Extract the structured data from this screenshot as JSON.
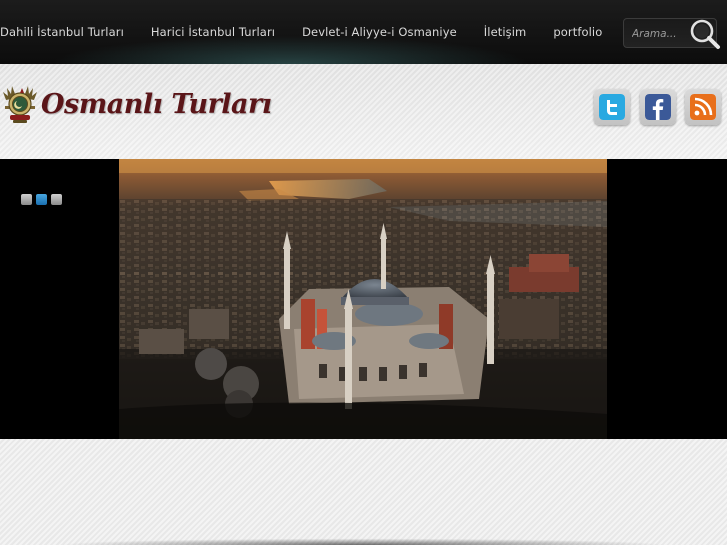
{
  "nav": {
    "items": [
      {
        "label": "Dahili İstanbul Turları"
      },
      {
        "label": "Harici İstanbul Turları"
      },
      {
        "label": "Devlet-i Aliyye-i Osmaniye"
      },
      {
        "label": "İletişim"
      },
      {
        "label": "portfolio"
      }
    ]
  },
  "search": {
    "placeholder": "Arama..."
  },
  "logo": {
    "text": "Osmanlı Turları",
    "icon": "ottoman-coat-of-arms-icon",
    "color": "#5a1518"
  },
  "social": [
    {
      "name": "twitter",
      "icon": "twitter-icon",
      "color": "#29a9e1"
    },
    {
      "name": "facebook",
      "icon": "facebook-icon",
      "color": "#3b5998"
    },
    {
      "name": "rss",
      "icon": "rss-icon",
      "color": "#e86f1b"
    }
  ],
  "slider": {
    "slide_count": 3,
    "active_slide": 2,
    "image": "aerial view of Hagia Sophia at sunset"
  }
}
